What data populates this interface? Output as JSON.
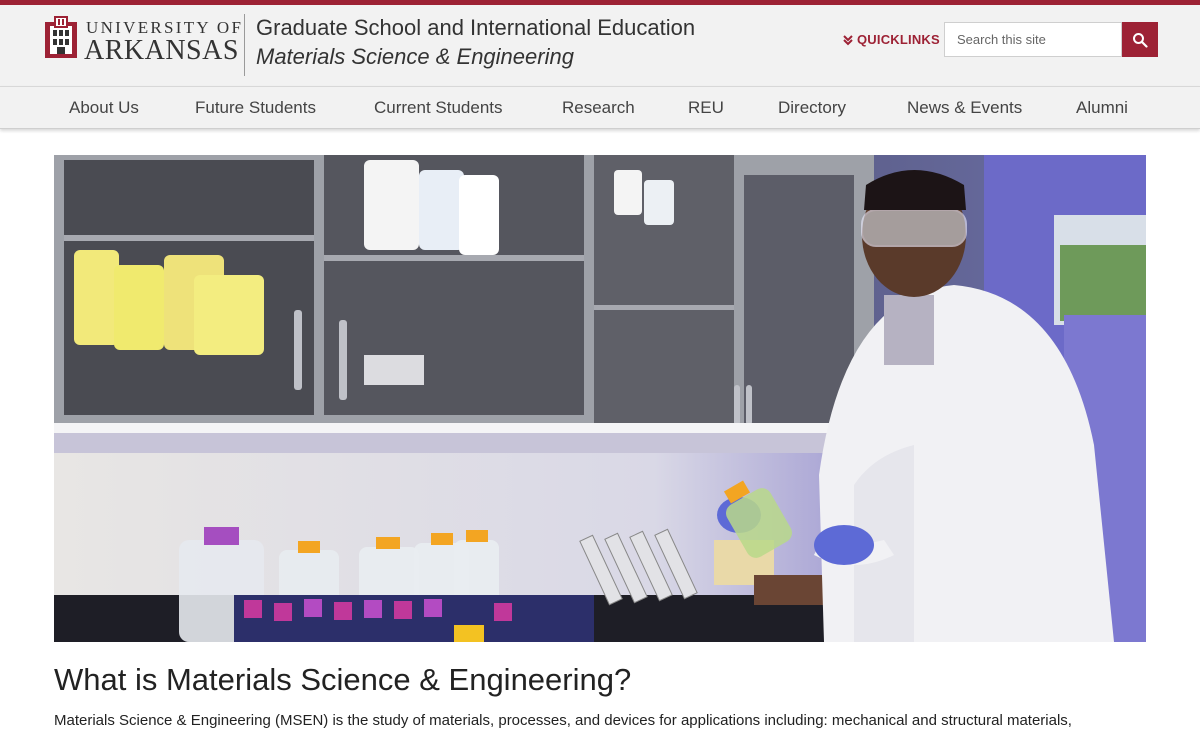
{
  "university": {
    "line1": "UNIVERSITY OF",
    "line2": "ARKANSAS"
  },
  "site": {
    "title": "Graduate School and International Education",
    "subtitle": "Materials Science & Engineering"
  },
  "utility": {
    "quicklinks_label": "QUICKLINKS",
    "search_placeholder": "Search this site"
  },
  "nav": {
    "items": [
      {
        "label": "About Us"
      },
      {
        "label": "Future Students"
      },
      {
        "label": "Current Students"
      },
      {
        "label": "Research"
      },
      {
        "label": "REU"
      },
      {
        "label": "Directory"
      },
      {
        "label": "News & Events"
      },
      {
        "label": "Alumni"
      }
    ]
  },
  "hero": {
    "image": "photo of researcher in lab coat holding a bottle in a chemistry lab"
  },
  "main": {
    "title": "What is Materials Science & Engineering?",
    "intro": "Materials Science & Engineering (MSEN) is the study of materials, processes, and devices for applications including: mechanical and structural materials,"
  },
  "colors": {
    "brand": "#9d2235",
    "header_bg": "#f2f2f2"
  }
}
